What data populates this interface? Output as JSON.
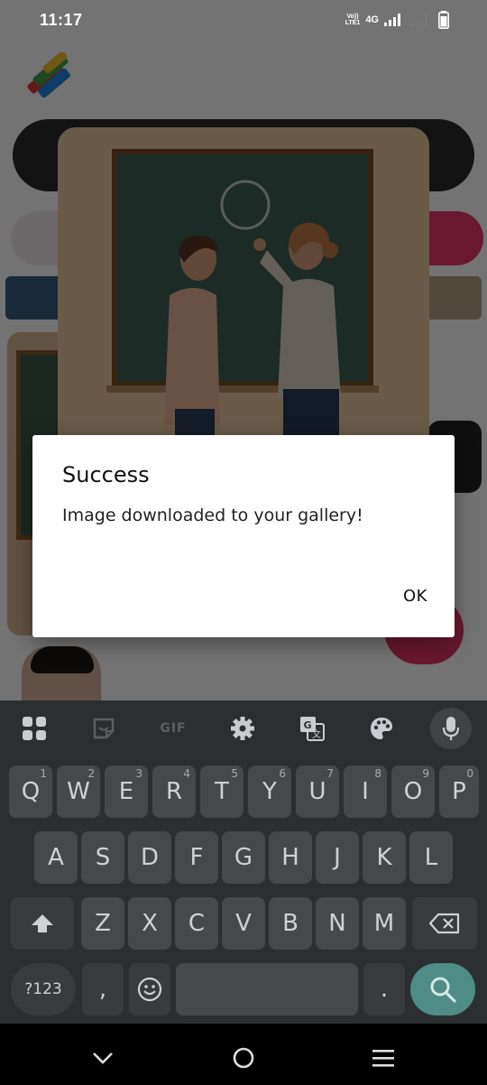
{
  "status_bar": {
    "time": "11:17",
    "network_label": "Vo))\nLTE1",
    "network_type": "4G",
    "icons": [
      "volte-icon",
      "signal-icon",
      "signal-weak-icon",
      "battery-icon"
    ]
  },
  "dialog": {
    "title": "Success",
    "message": "Image downloaded to your gallery!",
    "ok_label": "OK"
  },
  "keyboard": {
    "toolbar": {
      "items": [
        "apps-grid-icon",
        "sticker-icon",
        "gif-icon",
        "settings-icon",
        "translate-icon",
        "palette-icon",
        "mic-icon"
      ],
      "gif_label": "GIF"
    },
    "row1": [
      {
        "label": "Q",
        "hint": "1"
      },
      {
        "label": "W",
        "hint": "2"
      },
      {
        "label": "E",
        "hint": "3"
      },
      {
        "label": "R",
        "hint": "4"
      },
      {
        "label": "T",
        "hint": "5"
      },
      {
        "label": "Y",
        "hint": "6"
      },
      {
        "label": "U",
        "hint": "7"
      },
      {
        "label": "I",
        "hint": "8"
      },
      {
        "label": "O",
        "hint": "9"
      },
      {
        "label": "P",
        "hint": "0"
      }
    ],
    "row2": [
      "A",
      "S",
      "D",
      "F",
      "G",
      "H",
      "J",
      "K",
      "L"
    ],
    "row3": [
      "Z",
      "X",
      "C",
      "V",
      "B",
      "N",
      "M"
    ],
    "row4": {
      "symbols": "?123",
      "comma": ",",
      "period": "."
    }
  },
  "colors": {
    "accent_pink": "#e8356a",
    "search_key": "#4e8c85",
    "keyboard_bg": "#2c2f31",
    "key_bg": "#46494c"
  }
}
